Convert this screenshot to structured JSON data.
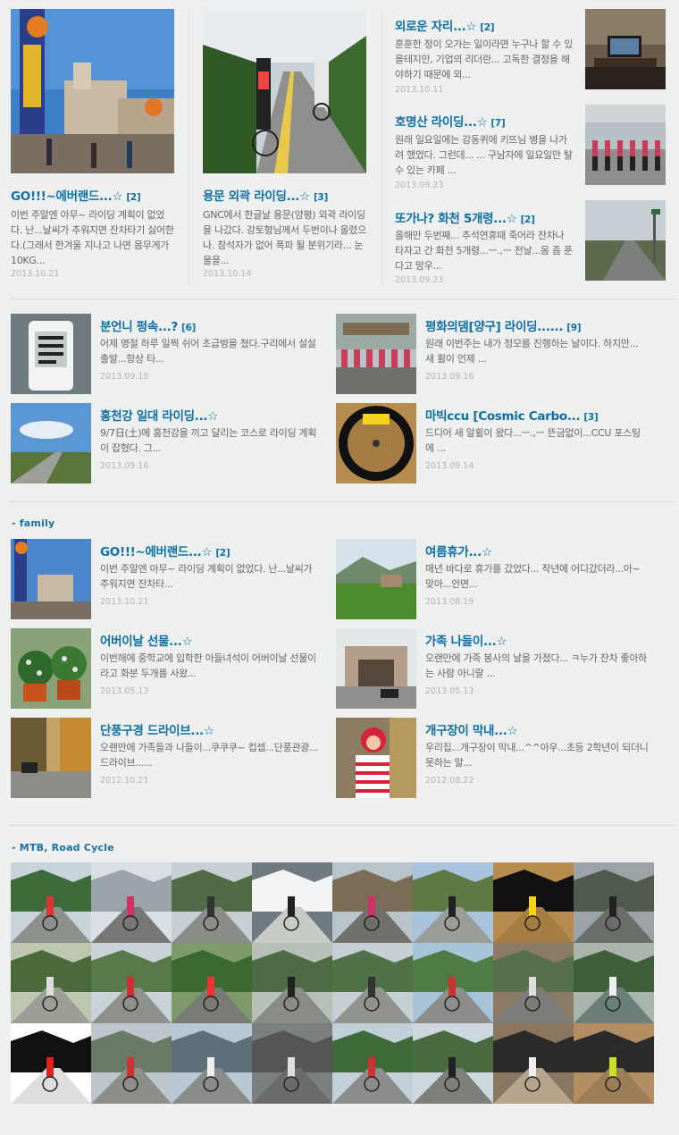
{
  "top_left": [
    {
      "title": "GO!!!~에버랜드...☆",
      "count": "[2]",
      "excerpt": "이번 주말엔 아무~ 라이딩 계획이 없었다. 난...날씨가 추워지면 잔차타기 싫어한다.(그래서 한겨울 지나고 나면 몸무게가 10KG...",
      "date": "2013.10.21"
    },
    {
      "title": "용문 외곽 라이딩...☆",
      "count": "[3]",
      "excerpt": "GNC에서 한글날 용문(양평) 외곽 라이딩을 나갔다. 강토형님께서 두번이나 올렸으나. 참석자가 없어 폭파 될 분위기라... 눈물을...",
      "date": "2013.10.14"
    }
  ],
  "top_right": [
    {
      "title": "외로운 자리...☆",
      "count": "[2]",
      "excerpt": "훈훈한 정이 오가는 일이라면 누구나 할 수 있을테지만, 기업의 리더란... 고독한 결정을 해야하기 때문에 외...",
      "date": "2013.10.11"
    },
    {
      "title": "호명산 라이딩...☆",
      "count": "[7]",
      "excerpt": "원래 일요일에는 강동퀴에 키뜨님 병을 나가려 했었다. 그런데... ... 구남자에 일요일만 탈수 있는 카페 ...",
      "date": "2013.09.23"
    },
    {
      "title": "또가나? 화천 5개령...☆",
      "count": "[2]",
      "excerpt": "올해만 두번째... 추석연휴때 죽어라 잔차나 타자고 간 화천 5개령...ㅡ.,ㅡ 전날...몸 좀 푼다고 망우...",
      "date": "2013.09.23"
    }
  ],
  "mid": [
    {
      "title": "분언니 펑속...?",
      "count": "[6]",
      "excerpt": "어제 명절 하루 일찍 쉬어 초급벙을 쳤다.구리에서 설설 출발...항상 타...",
      "date": "2013.09.18"
    },
    {
      "title": "평화의댐[양구] 라이딩......",
      "count": "[9]",
      "excerpt": "원래 이번주는 내가 정모를 진행하는 날이다. 하지만... 새 휠이 언제 ...",
      "date": "2013.09.16"
    },
    {
      "title": "홍천강 일대 라이딩...☆",
      "count": "",
      "excerpt": "9/7日(土)에 홍천강을 끼고 달리는 코스로 라이딩 계획이 잡혔다. 그...",
      "date": "2013.09.16"
    },
    {
      "title": "마빅ccu [Cosmic Carbo...",
      "count": "[3]",
      "excerpt": "드디어 새 알휠이 왔다...ㅡ.,ㅡ 뜬금없이...CCU 포스팅에 ...",
      "date": "2013.09.14"
    }
  ],
  "family_heading": "- family",
  "family": [
    {
      "title": "GO!!!~에버랜드...☆",
      "count": "[2]",
      "excerpt": "이번 주말엔 아무~ 라이딩 계획이 없었다. 난...날씨가 추워지면 잔차타...",
      "date": "2013.10.21"
    },
    {
      "title": "여름휴가...☆",
      "count": "",
      "excerpt": "매년 바다로 휴가를 갔었다... 작년에 어디갔더라...아~ 맞아...안면...",
      "date": "2013.08.19"
    },
    {
      "title": "어버이날 선물...☆",
      "count": "",
      "excerpt": "이번해에 중학교에 입학한 아들녀석이 어버이날 선물이라고 화분 두개를 사왔...",
      "date": "2013.05.13"
    },
    {
      "title": "가족 나들이...☆",
      "count": "",
      "excerpt": "오랜만에 가족 봉사의 날을 가졌다... ㅋ누가 잔차 좋아하는 사람 아니랄 ...",
      "date": "2013.05.13"
    },
    {
      "title": "단풍구경 드라이브...☆",
      "count": "",
      "excerpt": "오랜만에 가족들과 나들이...쿠쿠쿠~ 컵셉...단풍관광...드라이브......",
      "date": "2012.10.21"
    },
    {
      "title": "개구장이 막내...☆",
      "count": "",
      "excerpt": "우리집...개구장이 막내...^^아우...초등 2학년이 되더니 못하는 말...",
      "date": "2012.08.22"
    }
  ],
  "mtb_heading": "- MTB, Road Cycle",
  "gallery": [
    "riders-road",
    "group-photo",
    "road-cloudy",
    "bike-computer",
    "group-riders",
    "road-valley",
    "mavic-wheel",
    "road-dark",
    "road-tunnel",
    "rider-highway",
    "rider-forest",
    "rider-close",
    "rider-road",
    "rider-hill",
    "building-garden",
    "rider-bridge",
    "cycling-jersey",
    "rider-guardrail",
    "station-bikes",
    "tunnel-rider",
    "rider-mountain",
    "group-seated",
    "bike-indoor",
    "bike-yellow"
  ],
  "colors": {
    "title": "#0d6fa8",
    "date": "#b4b4b4",
    "bg": "#eef0f0"
  }
}
